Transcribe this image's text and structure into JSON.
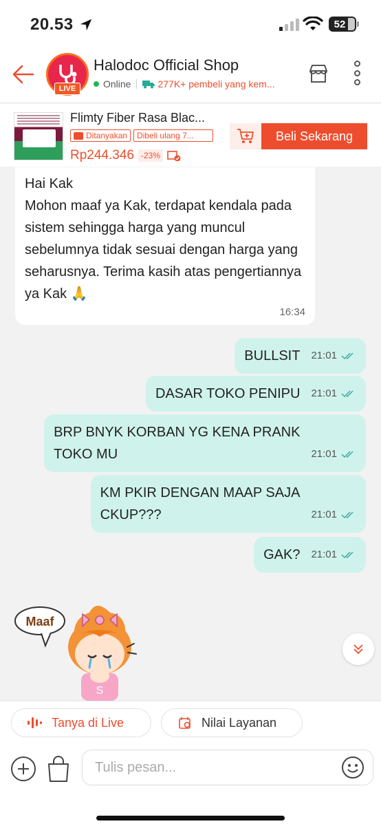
{
  "status_bar": {
    "time": "20.53",
    "battery": "52"
  },
  "header": {
    "shop_name": "Halodoc Official Shop",
    "live_badge": "LIVE",
    "status": "Online",
    "buyers": "277K+ pembeli yang kem..."
  },
  "product": {
    "title": "Flimty Fiber Rasa Blac...",
    "tag_asked": "Ditanyakan",
    "tag_repurchase": "Dibeli ulang 7...",
    "price": "Rp244.346",
    "discount": "-23%",
    "buy_label": "Beli Sekarang"
  },
  "messages": [
    {
      "from": "shop",
      "text": "Hai Kak\nMohon maaf ya Kak, terdapat kendala pada sistem sehingga harga yang muncul sebelumnya tidak sesuai dengan harga yang seharusnya. Terima kasih atas pengertiannya ya Kak 🙏",
      "time": "16:34"
    },
    {
      "from": "me",
      "text": "BULLSIT",
      "time": "21:01"
    },
    {
      "from": "me",
      "text": "DASAR TOKO PENIPU",
      "time": "21:01"
    },
    {
      "from": "me",
      "text": "BRP BNYK KORBAN YG KENA PRANK\nTOKO MU",
      "time": "21:01"
    },
    {
      "from": "me",
      "text": "KM PKIR DENGAN MAAP SAJA\nCKUP???",
      "time": "21:01"
    },
    {
      "from": "me",
      "text": "GAK?",
      "time": "21:01"
    }
  ],
  "sticker": {
    "text": "Maaf",
    "shirt_letter": "S"
  },
  "quick_actions": {
    "live": "Tanya di Live",
    "rating": "Nilai Layanan"
  },
  "composer": {
    "placeholder": "Tulis pesan..."
  },
  "colors": {
    "accent": "#ee4d2d",
    "outgoing_bubble": "#cff3ec",
    "read_ticks": "#3aa7a0"
  }
}
